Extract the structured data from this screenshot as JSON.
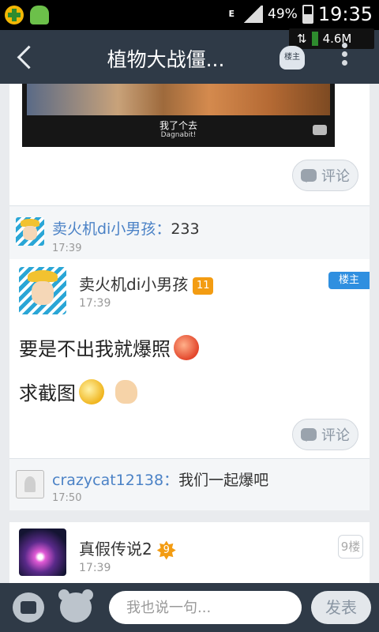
{
  "status_bar": {
    "battery": "49%",
    "time": "19:35",
    "network_type": "E",
    "traffic_speed": "4.6M",
    "left_icons": [
      "plus-circle-icon",
      "ghost-icon"
    ]
  },
  "header": {
    "title": "植物大战僵...",
    "floor_owner_button": "楼主"
  },
  "posts": {
    "image_post": {
      "image_caption": "我了个去",
      "image_caption_en": "Dagnabit!",
      "comment_button": "评论",
      "reply": {
        "author": "卖火机di小男孩：",
        "text": "233",
        "time": "17:39"
      }
    },
    "op_post": {
      "author": "卖火机di小男孩",
      "level": "11",
      "time": "17:39",
      "badge": "楼主",
      "line1": "要是不出我就爆照",
      "line2": "求截图",
      "comment_button": "评论",
      "reply": {
        "author": "crazycat12138：",
        "text": "我们一起爆吧",
        "time": "17:50"
      }
    },
    "next_post": {
      "author": "真假传说2",
      "level": "9",
      "time": "17:39",
      "floor": "9楼"
    }
  },
  "bottom_bar": {
    "input_placeholder": "我也说一句...",
    "send_button": "发表"
  },
  "colors": {
    "header_bg": "#2f3a47",
    "name_link": "#4b82c6",
    "badge_blue": "#2f8fe0",
    "level_orange": "#f39c12"
  }
}
